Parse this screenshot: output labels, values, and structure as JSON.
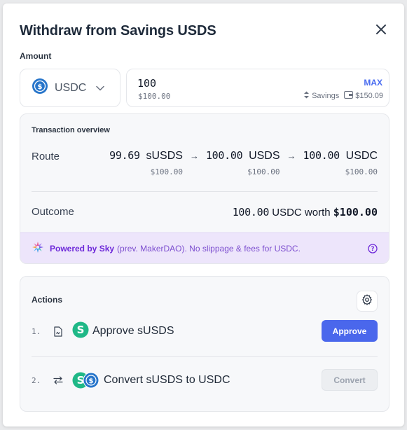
{
  "dialog": {
    "title": "Withdraw from Savings USDS"
  },
  "amount": {
    "label": "Amount",
    "token": "USDC",
    "value": "100",
    "usd_value": "$100.00",
    "max_label": "MAX",
    "balance_source": "Savings",
    "balance_value": "$150.09"
  },
  "overview": {
    "title": "Transaction overview",
    "route_label": "Route",
    "route": [
      {
        "amount": "99.69",
        "unit": "sUSDS",
        "usd": "$100.00"
      },
      {
        "amount": "100.00",
        "unit": "USDS",
        "usd": "$100.00"
      },
      {
        "amount": "100.00",
        "unit": "USDC",
        "usd": "$100.00"
      }
    ],
    "arrow": "→",
    "outcome_label": "Outcome",
    "outcome_amount": "100.00",
    "outcome_text": "USDC worth",
    "outcome_usd": "$100.00",
    "banner_powered": "Powered by Sky",
    "banner_rest": "(prev. MakerDAO). No slippage & fees for USDC."
  },
  "actions": {
    "title": "Actions",
    "items": [
      {
        "index": "1.",
        "label": "Approve sUSDS",
        "button": "Approve",
        "enabled": true
      },
      {
        "index": "2.",
        "label": "Convert sUSDS to USDC",
        "button": "Convert",
        "enabled": false
      }
    ]
  },
  "icons": {
    "close": "close-icon",
    "token": "usdc-token-icon",
    "chevron": "chevron-down-icon",
    "savings": "savings-icon",
    "wallet": "wallet-icon",
    "sky": "sky-logo-icon",
    "help": "question-icon",
    "gear": "gear-icon",
    "approve_step": "document-sign-icon",
    "convert_step": "swap-arrows-icon",
    "susds": "susds-token-icon"
  },
  "colors": {
    "primary": "#4a67ec",
    "accent_link": "#4a6cf0",
    "banner_bg": "#ede5fb",
    "banner_text": "#6d28d9",
    "usdc": "#2775ca",
    "susds": "#1fb887"
  }
}
